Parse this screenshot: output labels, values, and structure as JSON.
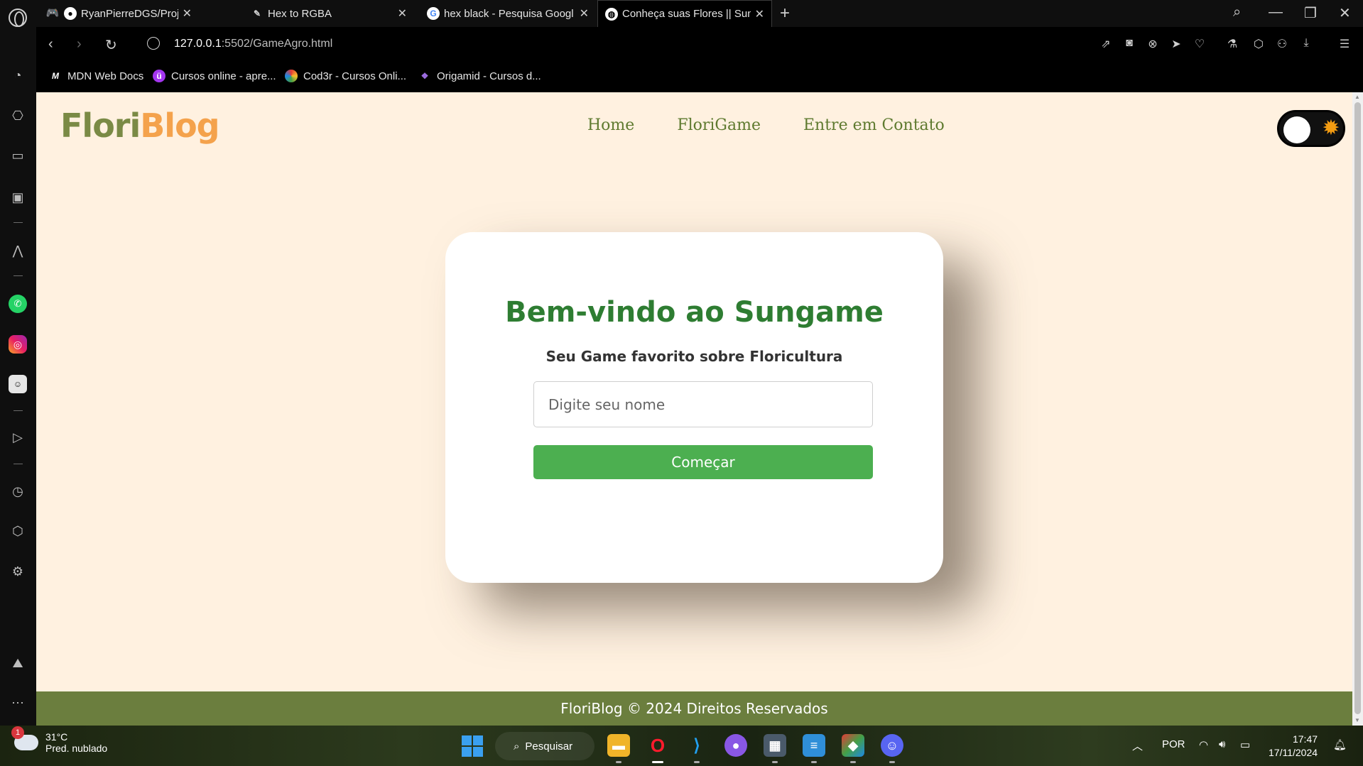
{
  "browser": {
    "tabs": [
      {
        "title": "RyanPierreDGS/Projeto-Int",
        "favicon": "github-icon",
        "active": false
      },
      {
        "title": "Hex to RGBA",
        "favicon": "eyedropper-icon",
        "active": false
      },
      {
        "title": "hex black - Pesquisa Googl",
        "favicon": "google-icon",
        "active": false
      },
      {
        "title": "Conheça suas Flores || Sung",
        "favicon": "globe-icon",
        "active": true
      }
    ],
    "url_host": "127.0.0.1",
    "url_path": ":5502/GameAgro.html",
    "bookmarks": [
      {
        "label": "MDN Web Docs",
        "icon": "mdn-icon"
      },
      {
        "label": "Cursos online - apre...",
        "icon": "udemy-icon"
      },
      {
        "label": "Cod3r - Cursos Onli...",
        "icon": "cod3r-icon"
      },
      {
        "label": "Origamid - Cursos d...",
        "icon": "origamid-icon"
      }
    ]
  },
  "site": {
    "logo_part1": "Flori",
    "logo_part2": "Blog",
    "nav": [
      "Home",
      "FloriGame",
      "Entre em Contato"
    ],
    "theme_toggle_icon": "sun-icon",
    "colors": {
      "background": "#fff1e0",
      "logo_green": "#7a8a45",
      "logo_orange": "#f4a24c",
      "title_green": "#2e7d32",
      "button_green": "#4caf50",
      "footer_green": "#6b7e3e"
    }
  },
  "card": {
    "title": "Bem-vindo ao Sungame",
    "subtitle": "Seu Game favorito sobre Floricultura",
    "name_placeholder": "Digite seu nome",
    "start_button": "Começar"
  },
  "footer": {
    "text": "FloriBlog © 2024 Direitos Reservados"
  },
  "taskbar": {
    "weather_temp": "31°C",
    "weather_desc": "Pred. nublado",
    "weather_badge": "1",
    "search_label": "Pesquisar",
    "language": "POR",
    "time": "17:47",
    "date": "17/11/2024"
  }
}
